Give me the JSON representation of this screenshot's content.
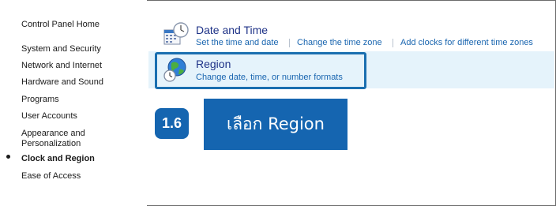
{
  "sidebar": {
    "home": "Control Panel Home",
    "items": [
      {
        "label": "System and Security"
      },
      {
        "label": "Network and Internet"
      },
      {
        "label": "Hardware and Sound"
      },
      {
        "label": "Programs"
      },
      {
        "label": "User Accounts"
      },
      {
        "label": "Appearance and Personalization"
      },
      {
        "label": "Clock and Region"
      },
      {
        "label": "Ease of Access"
      }
    ]
  },
  "main": {
    "date_time": {
      "title": "Date and Time",
      "links": [
        "Set the time and date",
        "Change the time zone",
        "Add clocks for different time zones"
      ]
    },
    "region": {
      "title": "Region",
      "link": "Change date, time, or number formats"
    }
  },
  "annotation": {
    "step": "1.6",
    "text": "เลือก Region"
  },
  "colors": {
    "title": "#1e3287",
    "link": "#1a66b0",
    "highlight": "#1565b0",
    "row_bg": "#e5f3fb"
  }
}
